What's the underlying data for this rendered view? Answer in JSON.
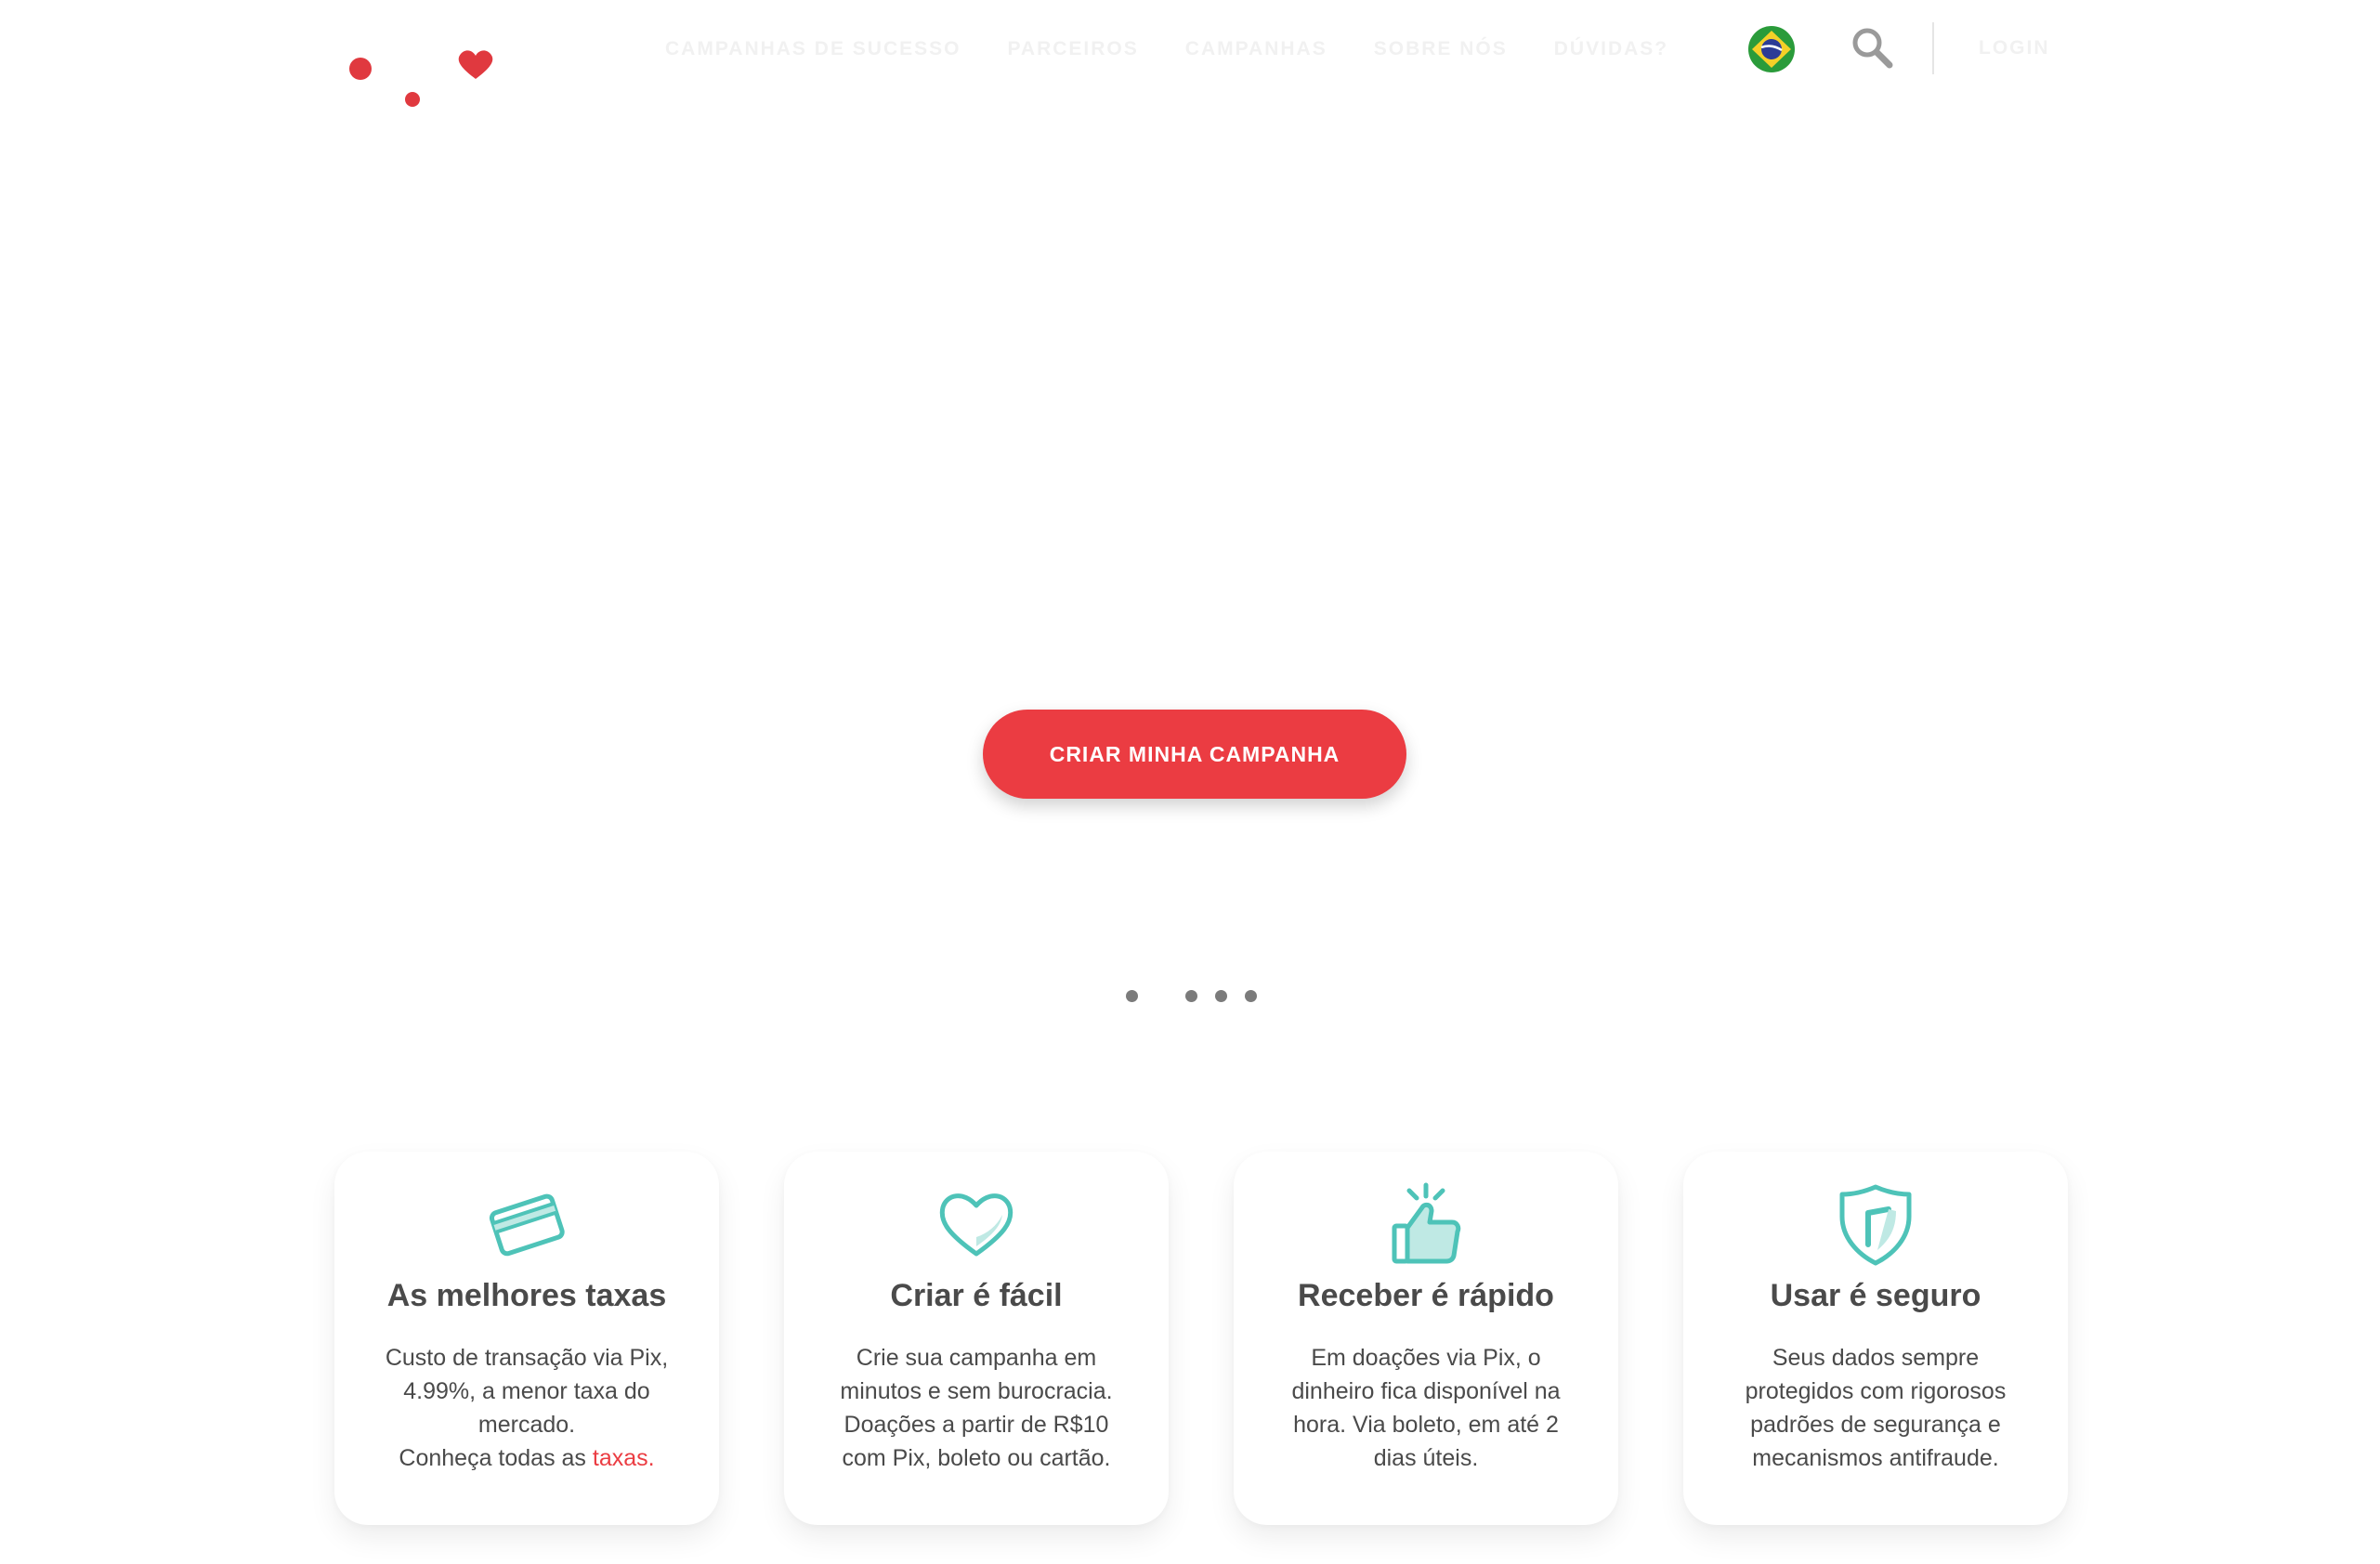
{
  "header": {
    "nav": [
      "CAMPANHAS DE SUCESSO",
      "PARCEIROS",
      "CAMPANHAS",
      "SOBRE NÓS",
      "DÚVIDAS?"
    ],
    "login_label": "LOGIN",
    "flag_icon": "brazil-flag-icon",
    "search_icon": "search-icon",
    "logo_icon": "heart-dots-logo"
  },
  "hero": {
    "cta_label": "CRIAR MINHA CAMPANHA",
    "carousel_dots": 4
  },
  "features": [
    {
      "icon": "credit-card-icon",
      "title": "As melhores taxas",
      "text_lines": [
        "Custo de transação via Pix,",
        "4.99%, a menor taxa do",
        "mercado."
      ],
      "link_prefix": "Conheça todas as ",
      "link_label": "taxas."
    },
    {
      "icon": "heart-icon",
      "title": "Criar é fácil",
      "text_lines": [
        "Crie sua campanha em",
        "minutos e sem burocracia.",
        "Doações a partir de R$10",
        "com Pix, boleto ou cartão."
      ]
    },
    {
      "icon": "thumbs-up-icon",
      "title": "Receber é rápido",
      "text_lines": [
        "Em doações via Pix, o",
        "dinheiro fica disponível na",
        "hora. Via boleto, em até 2",
        "dias úteis."
      ]
    },
    {
      "icon": "shield-icon",
      "title": "Usar é seguro",
      "text_lines": [
        "Seus dados sempre",
        "protegidos com rigorosos",
        "padrões de segurança e",
        "mecanismos antifraude."
      ]
    }
  ],
  "colors": {
    "accent_red": "#eb3c42",
    "teal": "#4ec3b8",
    "text_dark": "#4a4a4a"
  }
}
